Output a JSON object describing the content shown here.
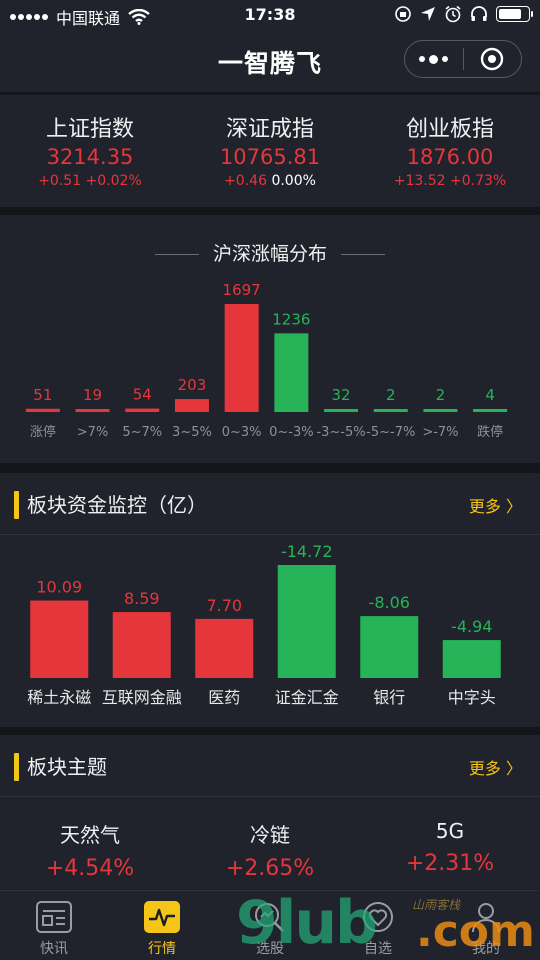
{
  "status_bar": {
    "carrier": "中国联通",
    "time": "17:38"
  },
  "nav": {
    "title": "一智腾飞"
  },
  "indices": [
    {
      "name": "上证指数",
      "value": "3214.35",
      "change": "+0.51",
      "percent": "+0.02%",
      "percent_color": "#e5363c"
    },
    {
      "name": "深证成指",
      "value": "10765.81",
      "change": "+0.46",
      "percent": "0.00%",
      "percent_color": "#ffffff"
    },
    {
      "name": "创业板指",
      "value": "1876.00",
      "change": "+13.52",
      "percent": "+0.73%",
      "percent_color": "#e5363c"
    }
  ],
  "distribution": {
    "title": "沪深涨幅分布"
  },
  "chart_data": [
    {
      "type": "bar",
      "title": "沪深涨幅分布",
      "categories": [
        "涨停",
        ">7%",
        "5~7%",
        "3~5%",
        "0~3%",
        "0~-3%",
        "-3~-5%",
        "-5~-7%",
        ">-7%",
        "跌停"
      ],
      "values": [
        51,
        19,
        54,
        203,
        1697,
        1236,
        32,
        2,
        2,
        4
      ],
      "colors": [
        "#e5363c",
        "#e5363c",
        "#e5363c",
        "#e5363c",
        "#e5363c",
        "#27b357",
        "#27b357",
        "#27b357",
        "#27b357",
        "#27b357"
      ],
      "ylim": [
        0,
        1697
      ],
      "grid": false
    },
    {
      "type": "bar",
      "title": "板块资金监控（亿）",
      "categories": [
        "稀土永磁",
        "互联网金融",
        "医药",
        "证金汇金",
        "银行",
        "中字头"
      ],
      "values": [
        10.09,
        8.59,
        7.7,
        -14.72,
        -8.06,
        -4.94
      ],
      "labels": [
        "10.09",
        "8.59",
        "7.70",
        "-14.72",
        "-8.06",
        "-4.94"
      ],
      "colors": [
        "#e5363c",
        "#e5363c",
        "#e5363c",
        "#27b357",
        "#27b357",
        "#27b357"
      ],
      "note_abs_height": true,
      "grid": false
    }
  ],
  "funds_section": {
    "title": "板块资金监控（亿）",
    "more": "更多 〉"
  },
  "themes_section": {
    "title": "板块主题",
    "more": "更多 〉",
    "items": [
      {
        "name": "天然气",
        "percent": "+4.54%"
      },
      {
        "name": "冷链",
        "percent": "+2.65%"
      },
      {
        "name": "5G",
        "percent": "+2.31%"
      }
    ]
  },
  "tabs": [
    {
      "label": "快讯",
      "icon": "news-icon",
      "active": false
    },
    {
      "label": "行情",
      "icon": "pulse-icon",
      "active": true
    },
    {
      "label": "选股",
      "icon": "stock-pick-icon",
      "active": false
    },
    {
      "label": "自选",
      "icon": "favorite-icon",
      "active": false
    },
    {
      "label": "我的",
      "icon": "user-icon",
      "active": false
    }
  ],
  "watermark": {
    "main": "9lub",
    "suffix": ".com",
    "small": "山雨客栈"
  }
}
